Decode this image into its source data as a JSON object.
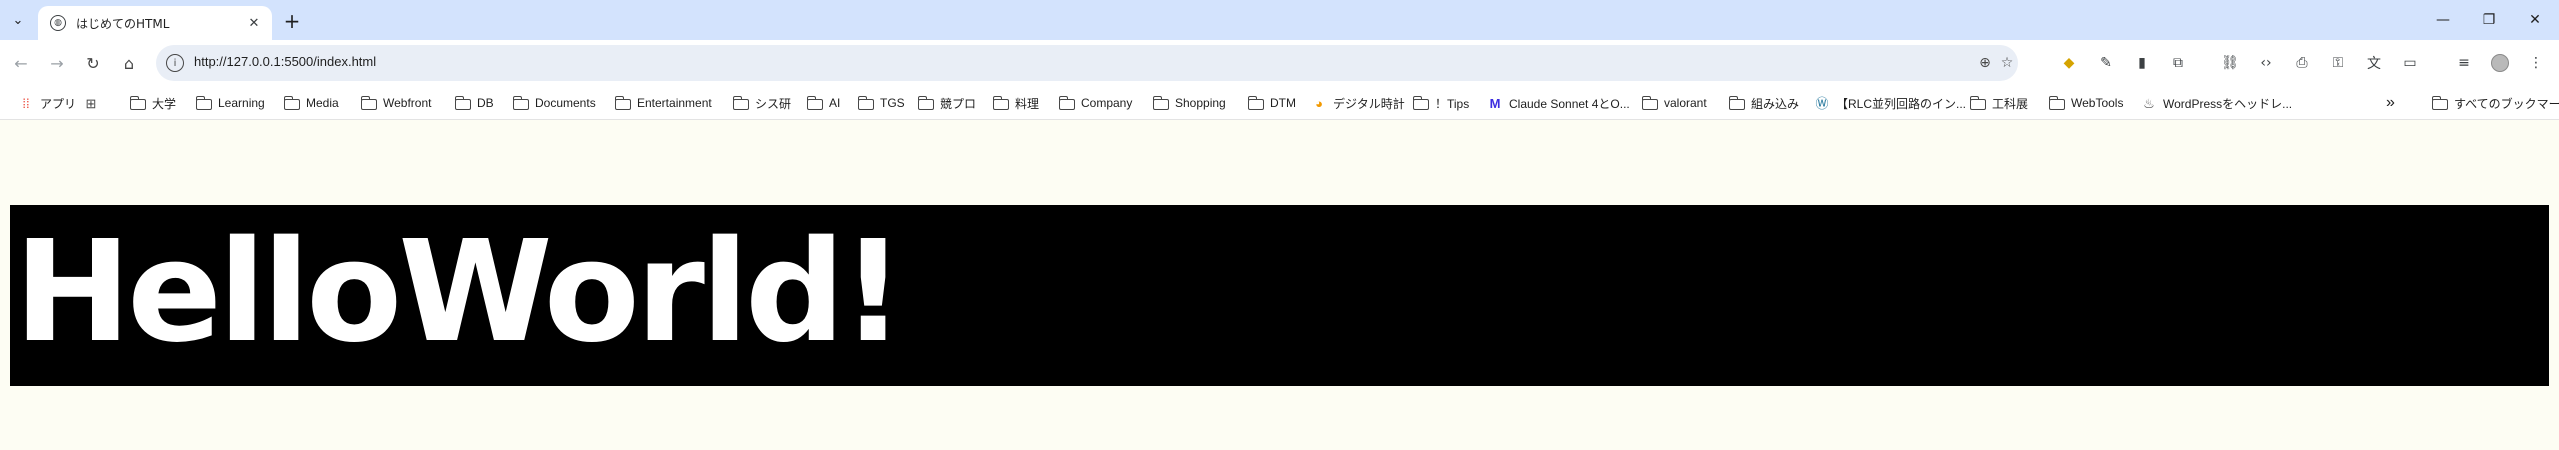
{
  "browser": {
    "tab": {
      "title": "はじめてのHTML"
    },
    "new_tab": "+",
    "window_controls": {
      "minimize": "—",
      "restore": "❐",
      "close": "✕"
    },
    "address_bar": {
      "url": "http://127.0.0.1:5500/index.html"
    }
  },
  "bookmarks": [
    {
      "label": "アプリ",
      "icon": "apps-grid-icon"
    },
    {
      "label": "",
      "icon": "tab-groups-icon"
    },
    {
      "label": "大学",
      "icon": "folder-icon"
    },
    {
      "label": "Learning",
      "icon": "folder-icon"
    },
    {
      "label": "Media",
      "icon": "folder-icon"
    },
    {
      "label": "Webfront",
      "icon": "folder-icon"
    },
    {
      "label": "DB",
      "icon": "folder-icon"
    },
    {
      "label": "Documents",
      "icon": "folder-icon"
    },
    {
      "label": "Entertainment",
      "icon": "folder-icon"
    },
    {
      "label": "シス研",
      "icon": "folder-icon"
    },
    {
      "label": "AI",
      "icon": "folder-icon"
    },
    {
      "label": "TGS",
      "icon": "folder-icon"
    },
    {
      "label": "競プロ",
      "icon": "folder-icon"
    },
    {
      "label": "料理",
      "icon": "folder-icon"
    },
    {
      "label": "Company",
      "icon": "folder-icon"
    },
    {
      "label": "Shopping",
      "icon": "folder-icon"
    },
    {
      "label": "DTM",
      "icon": "folder-icon"
    },
    {
      "label": "デジタル時計",
      "icon": "clock-favicon-icon"
    },
    {
      "label": "！Tips",
      "icon": "folder-icon"
    },
    {
      "label": "Claude Sonnet 4とO...",
      "icon": "m-favicon-icon"
    },
    {
      "label": "valorant",
      "icon": "folder-icon"
    },
    {
      "label": "組み込み",
      "icon": "folder-icon"
    },
    {
      "label": "【RLC並列回路のイン...",
      "icon": "wordpress-icon"
    },
    {
      "label": "工科展",
      "icon": "folder-icon"
    },
    {
      "label": "WebTools",
      "icon": "folder-icon"
    },
    {
      "label": "WordPressをヘッドレ...",
      "icon": "bookmark-favicon-icon"
    }
  ],
  "bookmarks_overflow": "»",
  "all_bookmarks": {
    "label": "すべてのブックマーク"
  },
  "page": {
    "heading": "HelloWorld!"
  }
}
